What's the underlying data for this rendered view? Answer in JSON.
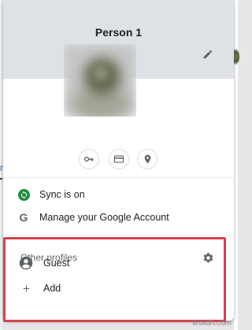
{
  "background": {
    "left_link_text": "n"
  },
  "profile": {
    "name": "Person 1",
    "edit_icon": "pencil-icon"
  },
  "quick_actions": [
    {
      "name": "passwords",
      "icon": "key-icon"
    },
    {
      "name": "payment-methods",
      "icon": "credit-card-icon"
    },
    {
      "name": "addresses",
      "icon": "location-pin-icon"
    }
  ],
  "menu": {
    "sync_label": "Sync is on",
    "manage_account_label": "Manage your Google Account"
  },
  "other_profiles": {
    "title": "Other profiles",
    "guest_label": "Guest",
    "add_label": "Add"
  },
  "colors": {
    "header_bg": "#dee1e6",
    "sync_green": "#1e8e3e",
    "highlight_red": "#d4424d",
    "icon_gray": "#5f6368",
    "background_link_blue": "#1a73e8"
  },
  "watermark": "wsxdn.com"
}
